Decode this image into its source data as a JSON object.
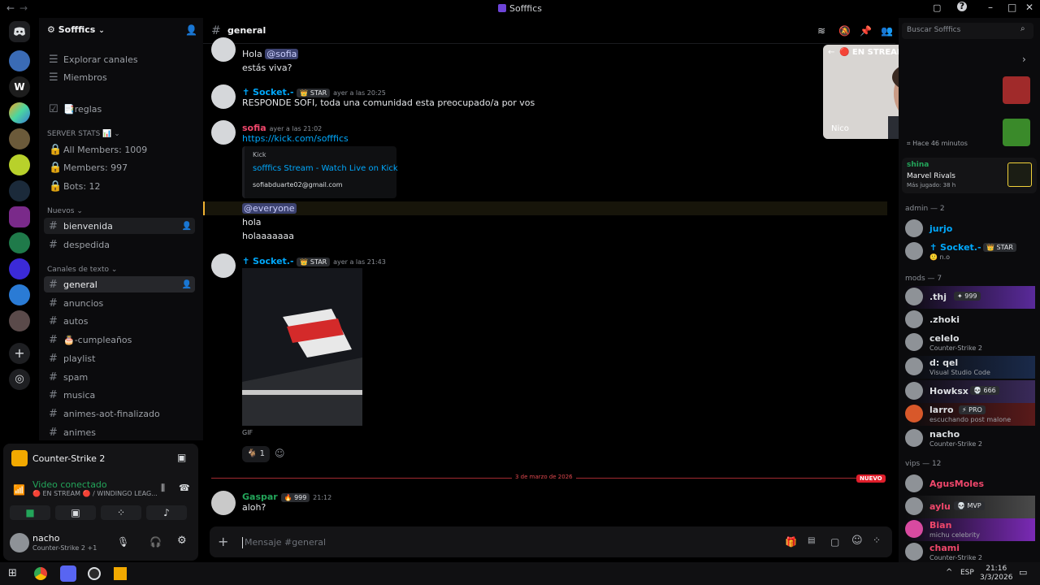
{
  "window": {
    "title": "Sofffics"
  },
  "server": {
    "name": "Sofffics"
  },
  "sidebar": {
    "top_items": [
      {
        "label": "Explorar canales",
        "icon": "browse-channels-icon"
      },
      {
        "label": "Miembros",
        "icon": "members-icon"
      }
    ],
    "rules_label": "📑reglas",
    "stats_category": "SERVER STATS 📊",
    "stats": [
      "All Members: 1009",
      "Members: 997",
      "Bots: 12"
    ],
    "nuevos_category": "Nuevos",
    "nuevos_channels": [
      "bienvenida",
      "despedida"
    ],
    "text_category": "Canales de texto",
    "text_channels": [
      "general",
      "anuncios",
      "autos",
      "🎂-cumpleaños",
      "playlist",
      "spam",
      "musica",
      "animes-aot-finalizado",
      "animes"
    ]
  },
  "voice_panel": {
    "game": "Counter-Strike 2",
    "status": "Video conectado",
    "stream_info": "🔴 EN STREAM 🔴 / WINDINGO LEAG...",
    "user_name": "nacho",
    "user_activity": "Counter-Strike 2 +1"
  },
  "channel_header": {
    "name": "general",
    "search_placeholder": "Buscar Sofffics"
  },
  "messages": {
    "m1_line1_prefix": "Hola ",
    "m1_mention": "@sofia",
    "m1_line2": "estás viva?",
    "m2_author": "✝ Socket.-",
    "m2_badge": "👑 STAR",
    "m2_time": "ayer a las 20:25",
    "m2_text": "RESPONDE SOFI, toda una comunidad esta preocupado/a por vos",
    "m3_author": "sofia",
    "m3_time": "ayer a las 21:02",
    "m3_link": "https://kick.com/sofffics",
    "embed_provider": "Kick",
    "embed_title": "sofffics Stream - Watch Live on Kick",
    "embed_desc": "sofiabduarte02@gmail.com",
    "m3_mention": "@everyone",
    "m3_l2": "hola",
    "m3_l3": "holaaaaaaa",
    "m4_author": "✝ Socket.-",
    "m4_badge": "👑 STAR",
    "m4_time": "ayer a las 21:43",
    "gif_label": "GIF",
    "reaction_count": "1",
    "divider_date": "3 de marzo de 2026",
    "divider_new": "NUEVO",
    "m5_author": "Gaspar",
    "m5_badge": "🔥 999",
    "m5_time": "21:12",
    "m5_text": "aloh?"
  },
  "composer": {
    "placeholder": "Mensaje #general"
  },
  "stream_overlay": {
    "title": "🔴 EN STREAM 🔴",
    "streamer": "Nico"
  },
  "members": {
    "activity_top": "Hace 46 minutos",
    "shina_name": "shina",
    "shina_game": "Marvel Rivals",
    "shina_time": "Más jugado: 38 h",
    "groups": {
      "admin": "admin — 2",
      "mods": "mods — 7",
      "vips": "vips — 12"
    },
    "admin": [
      {
        "name": "jurjo",
        "sub": "",
        "color": "#00a8fc"
      },
      {
        "name": "✝ Socket.-",
        "sub": "🙂 n.o",
        "badge": "👑 STAR",
        "color": "#00a8fc"
      }
    ],
    "mods": [
      {
        "name": ".thj",
        "sub": "",
        "badge": "✦ 999",
        "color": "#f2f3f5"
      },
      {
        "name": ".zhoki",
        "sub": "",
        "color": "#f2f3f5"
      },
      {
        "name": "celelo",
        "sub": "Counter-Strike 2",
        "color": "#f2f3f5"
      },
      {
        "name": "d: qel",
        "sub": "Visual Studio Code",
        "color": "#f2f3f5"
      },
      {
        "name": "Howksx",
        "sub": "",
        "badge": "💀 666",
        "color": "#f2f3f5"
      },
      {
        "name": "larro",
        "sub": "escuchando post malone",
        "badge": "⚡ PRO",
        "color": "#f2f3f5"
      },
      {
        "name": "nacho",
        "sub": "Counter-Strike 2",
        "color": "#f2f3f5"
      }
    ],
    "vips": [
      {
        "name": "AgusMoles",
        "sub": "",
        "color": "#f0476b"
      },
      {
        "name": "aylu",
        "sub": "",
        "badge": "💀 MVP",
        "color": "#f0476b"
      },
      {
        "name": "Bian",
        "sub": "michu celebrity",
        "color": "#f0476b"
      },
      {
        "name": "chami",
        "sub": "Counter-Strike 2",
        "color": "#f0476b"
      }
    ]
  },
  "taskbar": {
    "lang": "ESP",
    "time": "21:16",
    "date": "3/3/2026"
  },
  "colors": {
    "accent": "#5865f2",
    "link": "#00a8fc",
    "mention_bg": "#3c4270",
    "live_red": "#e01e2b",
    "online": "#23a55a"
  }
}
